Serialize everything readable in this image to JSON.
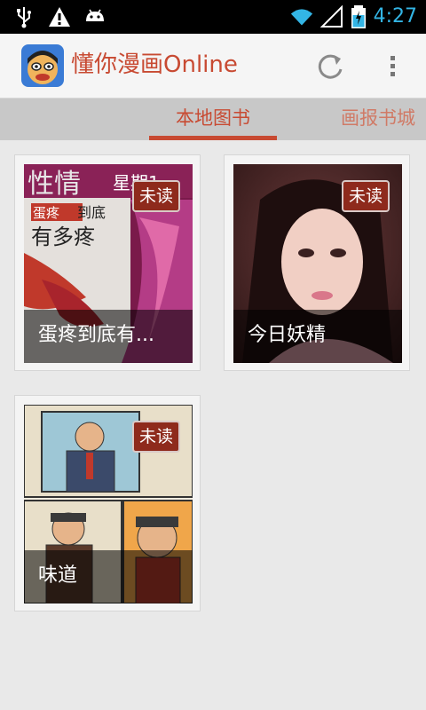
{
  "status_bar": {
    "time": "4:27",
    "icons": [
      "usb-icon",
      "warning-icon",
      "android-debug-icon",
      "wifi-icon",
      "signal-icon",
      "battery-charging-icon"
    ]
  },
  "action_bar": {
    "title": "懂你漫画Online",
    "actions": [
      "refresh-icon",
      "overflow-menu-icon"
    ]
  },
  "tabs": [
    {
      "label": "本地图书",
      "selected": true
    },
    {
      "label": "画报书城",
      "selected": false
    }
  ],
  "books": [
    {
      "title": "蛋疼到底有...",
      "badge": "未读",
      "cover": "magazine-cover"
    },
    {
      "title": "今日妖精",
      "badge": "未读",
      "cover": "portrait-photo"
    },
    {
      "title": "味道",
      "badge": "未读",
      "cover": "comic-strip"
    }
  ],
  "colors": {
    "accent": "#c84a32",
    "status_icons": "#33b5e5",
    "badge": "#8e2a1c"
  }
}
